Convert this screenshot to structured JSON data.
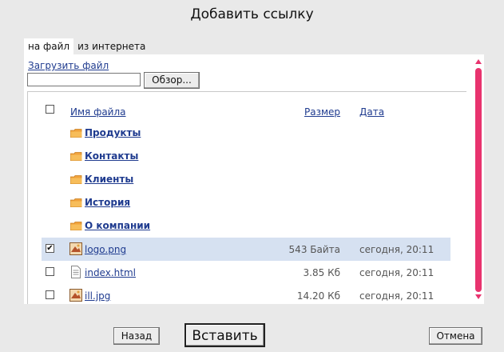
{
  "dialog": {
    "title": "Добавить ссылку"
  },
  "tabs": [
    {
      "label": "на файл",
      "active": true
    },
    {
      "label": "из интернета",
      "active": false
    }
  ],
  "upload": {
    "link_label": "Загрузить файл",
    "input_value": "",
    "browse_label": "Обзор..."
  },
  "table": {
    "headers": {
      "name": "Имя файла",
      "size": "Размер",
      "date": "Дата"
    },
    "select_all_checked": false,
    "folders": [
      {
        "name": "Продукты"
      },
      {
        "name": "Контакты"
      },
      {
        "name": "Клиенты"
      },
      {
        "name": "История"
      },
      {
        "name": "О компании"
      }
    ],
    "files": [
      {
        "name": "logo.png",
        "size": "543 Байта",
        "date": "сегодня, 20:11",
        "checked": true,
        "selected": true,
        "icon": "image-file-icon"
      },
      {
        "name": "index.html",
        "size": "3.85 Кб",
        "date": "сегодня, 20:11",
        "checked": false,
        "selected": false,
        "icon": "document-file-icon"
      },
      {
        "name": "ill.jpg",
        "size": "14.20 Кб",
        "date": "сегодня, 20:11",
        "checked": false,
        "selected": false,
        "icon": "image-file-icon"
      }
    ]
  },
  "buttons": {
    "back": "Назад",
    "insert": "Вставить",
    "cancel": "Отмена"
  },
  "colors": {
    "background": "#e9e9e9",
    "link": "#1f3b8f",
    "selected_row": "#d6e1f1",
    "scrollbar": "#e8336e",
    "folder": "#f0a23c"
  }
}
